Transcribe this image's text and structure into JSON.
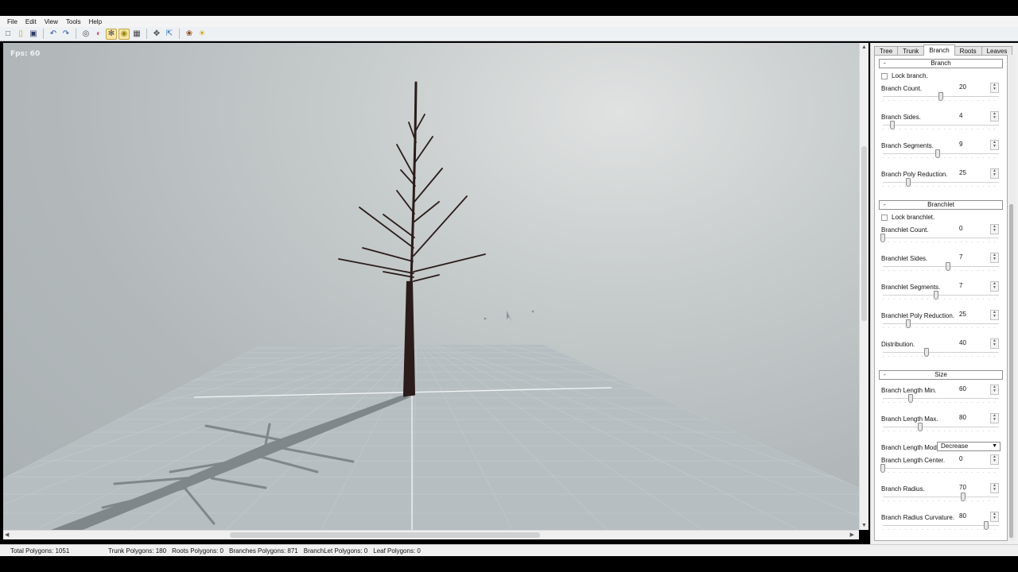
{
  "menu": [
    "File",
    "Edit",
    "View",
    "Tools",
    "Help"
  ],
  "toolbar": {
    "icons": [
      "new-file-icon",
      "open-folder-icon",
      "save-icon",
      "undo-icon",
      "redo-icon",
      "sphere-icon",
      "color-wheel-icon",
      "wireframe-icon",
      "light-bulb-icon",
      "grid-icon",
      "move-icon",
      "zoom-extents-icon",
      "tree-icon",
      "sun-icon"
    ]
  },
  "viewport": {
    "fps": "Fps: 60"
  },
  "status": {
    "total": "Total Polygons: 1051",
    "trunk": "Trunk Polygons: 180",
    "roots": "Roots Polygons: 0",
    "branches": "Branches Polygons: 871",
    "branchlet": "BranchLet Polygons: 0",
    "leaf": "Leaf Polygons: 0"
  },
  "panel": {
    "tabs": [
      "Tree",
      "Trunk",
      "Branch",
      "Roots",
      "Leaves"
    ],
    "active_tab": "Branch",
    "sections": {
      "branch": "Branch",
      "branchlet": "Branchlet",
      "size": "Size"
    },
    "lock_branch": "Lock branch.",
    "lock_branchlet": "Lock branchlet.",
    "fields": {
      "branch_count": {
        "label": "Branch Count.",
        "value": "20",
        "level": 0.5
      },
      "branch_sides": {
        "label": "Branch Sides.",
        "value": "4",
        "level": 0.08
      },
      "branch_segments": {
        "label": "Branch Segments.",
        "value": "9",
        "level": 0.47
      },
      "branch_poly_reduction": {
        "label": "Branch Poly Reduction.",
        "value": "25",
        "level": 0.22
      },
      "branchlet_count": {
        "label": "Branchlet Count.",
        "value": "0",
        "level": 0.0
      },
      "branchlet_sides": {
        "label": "Branchlet Sides.",
        "value": "7",
        "level": 0.56
      },
      "branchlet_segments": {
        "label": "Branchlet Segments.",
        "value": "7",
        "level": 0.46
      },
      "branchlet_poly_reduction": {
        "label": "Branchlet Poly Reduction.",
        "value": "25",
        "level": 0.22
      },
      "distribution": {
        "label": "Distribution.",
        "value": "40",
        "level": 0.38
      },
      "branch_length_min": {
        "label": "Branch Length Min.",
        "value": "60",
        "level": 0.24
      },
      "branch_length_max": {
        "label": "Branch Length Max.",
        "value": "80",
        "level": 0.32
      },
      "branch_length_center": {
        "label": "Branch Length Center.",
        "value": "0",
        "level": 0.0
      },
      "branch_radius": {
        "label": "Branch Radius.",
        "value": "70",
        "level": 0.69
      },
      "branch_radius_curvature": {
        "label": "Branch Radius Curvature.",
        "value": "80",
        "level": 0.89
      }
    },
    "length_mode": {
      "label": "Branch Length Mode.",
      "value": "Decrease"
    }
  }
}
